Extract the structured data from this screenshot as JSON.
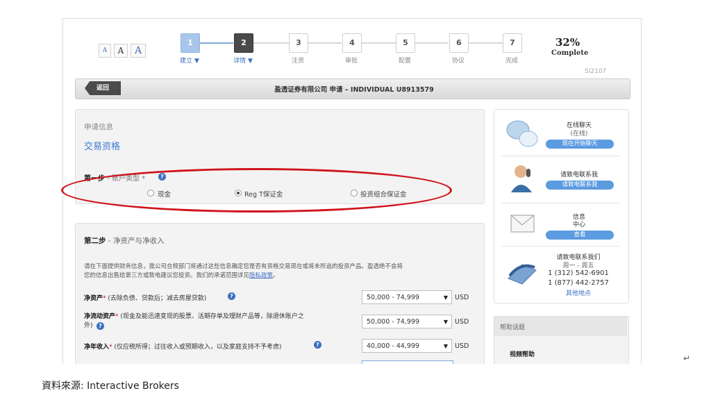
{
  "font_size": {
    "small": "A",
    "medium": "A",
    "large": "A"
  },
  "steps": [
    {
      "num": "1",
      "label": "建立 ▼",
      "state": "done"
    },
    {
      "num": "2",
      "label": "详情 ▼",
      "state": "current"
    },
    {
      "num": "3",
      "label": "注资",
      "state": "todo"
    },
    {
      "num": "4",
      "label": "审批",
      "state": "todo"
    },
    {
      "num": "5",
      "label": "配置",
      "state": "todo"
    },
    {
      "num": "6",
      "label": "协议",
      "state": "todo"
    },
    {
      "num": "7",
      "label": "完成",
      "state": "todo"
    }
  ],
  "progress": {
    "percent": "32%",
    "label": "Complete",
    "code": "SI2107"
  },
  "titlebar": {
    "back": "返回",
    "title": "盈透证券有限公司 申请 – INDIVIDUAL U8913579"
  },
  "section1": {
    "small": "申请信息",
    "heading": "交易资格",
    "step_label": "第一步",
    "step_sub": "- 账户类型 *",
    "options": [
      {
        "label": "现金",
        "selected": false
      },
      {
        "label": "Reg T保证金",
        "selected": true
      },
      {
        "label": "投资组合保证金",
        "selected": false
      }
    ]
  },
  "section2": {
    "step_label": "第二步",
    "step_sub": "- 净资产与净收入",
    "desc1": "请在下面提供财务信息，我公司合规部门将通过这些信息确定您是否有资格交易现在或将未所选的投资产品。盈透绝不会将",
    "desc2": "您的信息出售给第三方或致电建议您投资。我们的承诺范围详见",
    "privacy": "隐私政策",
    "desc_end": "。",
    "fields": [
      {
        "label": "净资产",
        "note": "(去除负债、贷款后；减去房屋贷款)",
        "value": "50,000 - 74,999",
        "unit": "USD"
      },
      {
        "label": "净流动资产",
        "note": "(现金及能迅速变现的股票、活期存单及理财产品等，除退休账户之",
        "note2": "外)",
        "value": "50,000 - 74,999",
        "unit": "USD"
      },
      {
        "label": "净年收入",
        "note": "(仅应税所得；过往收入或预期收入，以及家庭支持不予考虑)",
        "value": "40,000 - 44,999",
        "unit": "USD"
      }
    ]
  },
  "sidebar": {
    "chat": {
      "title": "在线聊天",
      "status": "(在线)",
      "button": "现在开始聊天"
    },
    "callback": {
      "title": "请致电联系我",
      "button": "请致电联系我"
    },
    "message": {
      "title1": "信息",
      "title2": "中心",
      "button": "查看"
    },
    "phone": {
      "title": "请致电联系我们",
      "hours": "周一 - 周五",
      "line1": "1 (312) 542-6901",
      "line2": "1 (877) 442-2757",
      "link": "其他地点"
    },
    "help": {
      "heading": "帮助话题",
      "item": "视频帮助"
    }
  },
  "caption": {
    "source": "資料來源: Interactive Brokers",
    "return_mark": "↵"
  },
  "colors": {
    "accent": "#3b6fc0",
    "highlight_ellipse": "#d0141b",
    "button_blue": "#5b9be0"
  }
}
